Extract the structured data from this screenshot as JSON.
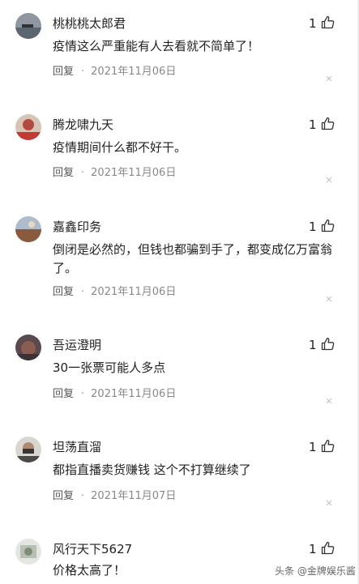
{
  "comments": [
    {
      "username": "桃桃桃太郎君",
      "likes": "1",
      "text": "疫情这么严重能有人去看就不简单了！",
      "reply_label": "回复",
      "separator": "·",
      "date": "2021年11月06日"
    },
    {
      "username": "腾龙啸九天",
      "likes": "1",
      "text": "疫情期间什么都不好干。",
      "reply_label": "回复",
      "separator": "·",
      "date": "2021年11月06日"
    },
    {
      "username": "嘉鑫印务",
      "likes": "1",
      "text": "倒闭是必然的，但钱也都骗到手了，都变成亿万富翁了。",
      "reply_label": "回复",
      "separator": "·",
      "date": "2021年11月06日"
    },
    {
      "username": "吾运澄明",
      "likes": "1",
      "text": "30一张票可能人多点",
      "reply_label": "回复",
      "separator": "·",
      "date": "2021年11月06日"
    },
    {
      "username": "坦荡直溜",
      "likes": "1",
      "text": "都指直播卖货赚钱 这个不打算继续了",
      "reply_label": "回复",
      "separator": "·",
      "date": "2021年11月07日"
    },
    {
      "username": "风行天下5627",
      "likes": "1",
      "text": "价格太高了！"
    }
  ],
  "watermark": "头条 @金牌娱乐酱"
}
